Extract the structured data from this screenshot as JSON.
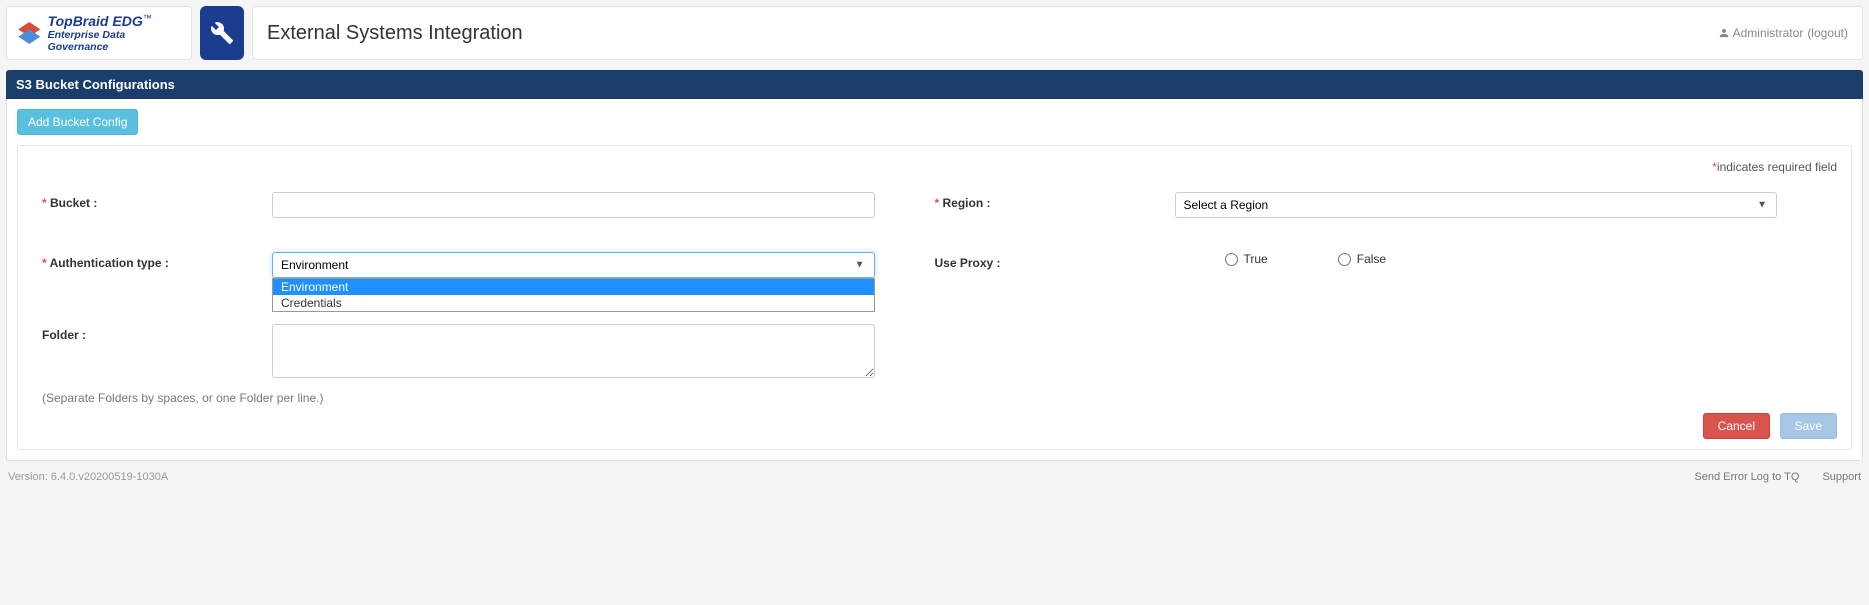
{
  "brand": {
    "line1": "TopBraid EDG",
    "line2": "Enterprise Data Governance"
  },
  "header": {
    "page_title": "External Systems Integration",
    "user_label": "Administrator",
    "logout_label": "(logout)"
  },
  "panel": {
    "title": "S3 Bucket Configurations",
    "add_button": "Add Bucket Config",
    "required_note": "indicates required field"
  },
  "form": {
    "bucket_label": "Bucket :",
    "bucket_value": "",
    "region_label": "Region :",
    "region_placeholder": "Select a Region",
    "auth_label": "Authentication type :",
    "auth_selected": "Environment",
    "auth_options": {
      "env": "Environment",
      "cred": "Credentials"
    },
    "proxy_label": "Use Proxy :",
    "proxy_true": "True",
    "proxy_false": "False",
    "folder_label": "Folder :",
    "folder_value": "",
    "folder_help": "(Separate Folders by spaces, or one Folder per line.)",
    "cancel": "Cancel",
    "save": "Save"
  },
  "footer": {
    "version": "Version: 6.4.0.v20200519-1030A",
    "send_log": "Send Error Log to TQ",
    "support": "Support"
  }
}
